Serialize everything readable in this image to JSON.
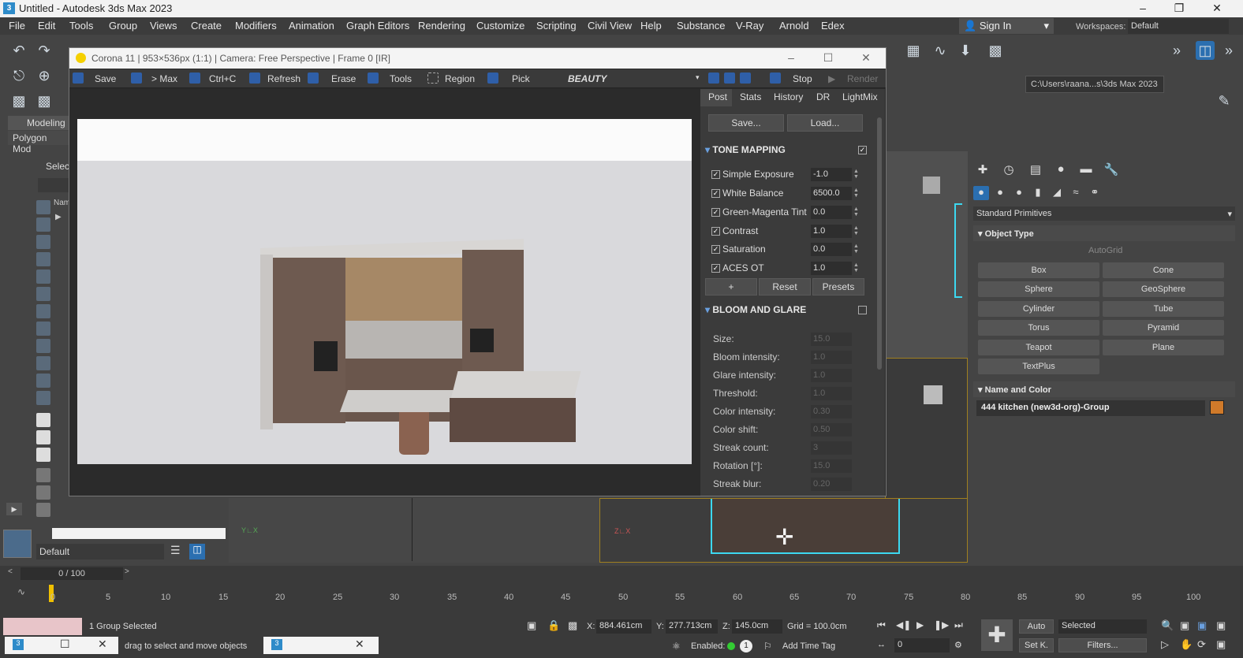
{
  "window": {
    "title": "Untitled - Autodesk 3ds Max 2023",
    "app_icon": "3"
  },
  "menu": [
    "File",
    "Edit",
    "Tools",
    "Group",
    "Views",
    "Create",
    "Modifiers",
    "Animation",
    "Graph Editors",
    "Rendering",
    "Customize",
    "Scripting",
    "Civil View",
    "Help",
    "Substance",
    "V-Ray",
    "Arnold",
    "Edex"
  ],
  "signin": "Sign In",
  "workspaces": {
    "label": "Workspaces:",
    "value": "Default"
  },
  "project_path": "C:\\Users\\raana...s\\3ds Max 2023",
  "ribbon": {
    "modeling": "Modeling",
    "polygon": "Polygon Mod"
  },
  "scene_explorer": {
    "select": "Selec",
    "name_col": "Nam"
  },
  "layer": {
    "value": "Default"
  },
  "vfb": {
    "title": "Corona 11 | 953×536px (1:1) | Camera: Free Perspective | Frame 0 [IR]",
    "toolbar": {
      "save": "Save",
      "max": "> Max",
      "copy": "Ctrl+C",
      "refresh": "Refresh",
      "erase": "Erase",
      "tools": "Tools",
      "region": "Region",
      "pick": "Pick",
      "channel": "BEAUTY",
      "stop": "Stop",
      "render": "Render"
    },
    "tabs": [
      "Post",
      "Stats",
      "History",
      "DR",
      "LightMix"
    ],
    "save_btn": "Save...",
    "load_btn": "Load...",
    "tone_mapping": {
      "title": "TONE MAPPING",
      "rows": [
        {
          "label": "Simple Exposure",
          "value": "-1.0"
        },
        {
          "label": "White Balance",
          "value": "6500.0"
        },
        {
          "label": "Green-Magenta Tint",
          "value": "0.0"
        },
        {
          "label": "Contrast",
          "value": "1.0"
        },
        {
          "label": "Saturation",
          "value": "0.0"
        },
        {
          "label": "ACES OT",
          "value": "1.0"
        }
      ],
      "plus": "+",
      "reset": "Reset",
      "presets": "Presets"
    },
    "bloom": {
      "title": "BLOOM AND GLARE",
      "rows": [
        {
          "label": "Size:",
          "value": "15.0"
        },
        {
          "label": "Bloom intensity:",
          "value": "1.0"
        },
        {
          "label": "Glare intensity:",
          "value": "1.0"
        },
        {
          "label": "Threshold:",
          "value": "1.0"
        },
        {
          "label": "Color intensity:",
          "value": "0.30"
        },
        {
          "label": "Color shift:",
          "value": "0.50"
        },
        {
          "label": "Streak count:",
          "value": "3"
        },
        {
          "label": "Rotation [°]:",
          "value": "15.0"
        },
        {
          "label": "Streak blur:",
          "value": "0.20"
        }
      ]
    }
  },
  "command_panel": {
    "category": "Standard Primitives",
    "object_type": "Object Type",
    "autogrid": "AutoGrid",
    "primitives": [
      "Box",
      "Cone",
      "Sphere",
      "GeoSphere",
      "Cylinder",
      "Tube",
      "Torus",
      "Pyramid",
      "Teapot",
      "Plane",
      "TextPlus"
    ],
    "name_and_color": "Name and Color",
    "object_name": "444 kitchen (new3d-org)-Group",
    "object_color": "#d07a2a"
  },
  "timeline": {
    "frame": "0 / 100",
    "ticks": [
      "0",
      "5",
      "10",
      "15",
      "20",
      "25",
      "30",
      "35",
      "40",
      "45",
      "50",
      "55",
      "60",
      "65",
      "70",
      "75",
      "80",
      "85",
      "90",
      "95",
      "100"
    ]
  },
  "status": {
    "selection": "1 Group Selected",
    "prompt": "drag to select and move objects",
    "x_label": "X:",
    "x": "884.461cm",
    "y_label": "Y:",
    "y": "277.713cm",
    "z_label": "Z:",
    "z": "145.0cm",
    "grid": "Grid = 100.0cm",
    "enabled": "Enabled:",
    "add_time_tag": "Add Time Tag",
    "auto": "Auto",
    "selected": "Selected",
    "setk": "Set K.",
    "filters": "Filters...",
    "frame_field": "0"
  }
}
